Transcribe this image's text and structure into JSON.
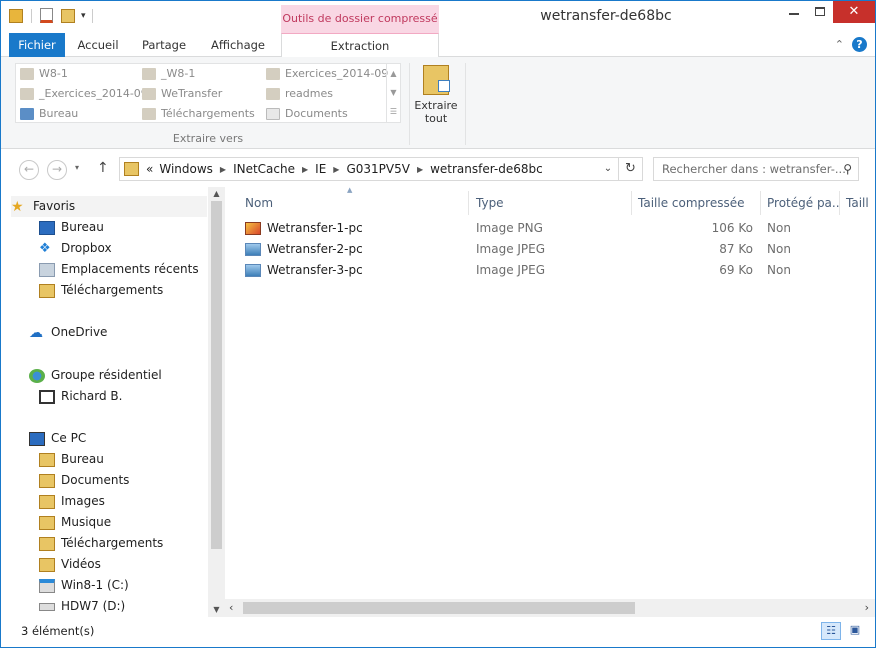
{
  "window": {
    "title": "wetransfer-de68bc",
    "context_tab": "Outils de dossier compressé"
  },
  "ribbon_tabs": [
    "Fichier",
    "Accueil",
    "Partage",
    "Affichage",
    "Extraction"
  ],
  "ribbon": {
    "destinations": [
      {
        "label": "W8-1",
        "icon": "folder-icon"
      },
      {
        "label": "_W8-1",
        "icon": "folder-icon"
      },
      {
        "label": "Exercices_2014-09",
        "icon": "folder-icon"
      },
      {
        "label": "_Exercices_2014-09",
        "icon": "folder-icon"
      },
      {
        "label": "WeTransfer",
        "icon": "folder-icon"
      },
      {
        "label": "readmes",
        "icon": "folder-icon"
      },
      {
        "label": "Bureau",
        "icon": "desktop-icon"
      },
      {
        "label": "Téléchargements",
        "icon": "downloads-icon"
      },
      {
        "label": "Documents",
        "icon": "documents-icon"
      }
    ],
    "group_label": "Extraire vers",
    "extract_all_line1": "Extraire",
    "extract_all_line2": "tout"
  },
  "address": {
    "crumbs": [
      "«",
      "Windows",
      "INetCache",
      "IE",
      "G031PV5V",
      "wetransfer-de68bc"
    ],
    "search_placeholder": "Rechercher dans : wetransfer-..."
  },
  "nav": {
    "items": [
      {
        "label": "Favoris",
        "icon": "star-icon"
      },
      {
        "label": "Bureau",
        "icon": "desktop-icon"
      },
      {
        "label": "Dropbox",
        "icon": "dropbox-icon"
      },
      {
        "label": "Emplacements récents",
        "icon": "recent-places-icon"
      },
      {
        "label": "Téléchargements",
        "icon": "downloads-icon"
      },
      {
        "label": "OneDrive",
        "icon": "cloud-icon"
      },
      {
        "label": "Groupe résidentiel",
        "icon": "homegroup-icon"
      },
      {
        "label": "Richard B.",
        "icon": "user-icon"
      },
      {
        "label": "Ce PC",
        "icon": "computer-icon"
      },
      {
        "label": "Bureau",
        "icon": "desktop-folder-icon"
      },
      {
        "label": "Documents",
        "icon": "documents-folder-icon"
      },
      {
        "label": "Images",
        "icon": "pictures-folder-icon"
      },
      {
        "label": "Musique",
        "icon": "music-folder-icon"
      },
      {
        "label": "Téléchargements",
        "icon": "downloads-folder-icon"
      },
      {
        "label": "Vidéos",
        "icon": "videos-folder-icon"
      },
      {
        "label": "Win8-1 (C:)",
        "icon": "drive-c-icon"
      },
      {
        "label": "HDW7 (D:)",
        "icon": "drive-d-icon"
      }
    ]
  },
  "columns": [
    "Nom",
    "Type",
    "Taille compressée",
    "Protégé pa...",
    "Taill"
  ],
  "files": [
    {
      "name": "Wetransfer-1-pc",
      "type": "Image PNG",
      "size": "106 Ko",
      "protected": "Non",
      "icon": "png-file-icon"
    },
    {
      "name": "Wetransfer-2-pc",
      "type": "Image JPEG",
      "size": "87 Ko",
      "protected": "Non",
      "icon": "jpeg-file-icon"
    },
    {
      "name": "Wetransfer-3-pc",
      "type": "Image JPEG",
      "size": "69 Ko",
      "protected": "Non",
      "icon": "jpeg-file-icon"
    }
  ],
  "status": {
    "count": "3 élément(s)"
  },
  "colors": {
    "accent": "#1979ca",
    "context": "#f9d7e4",
    "close": "#c7302b"
  }
}
